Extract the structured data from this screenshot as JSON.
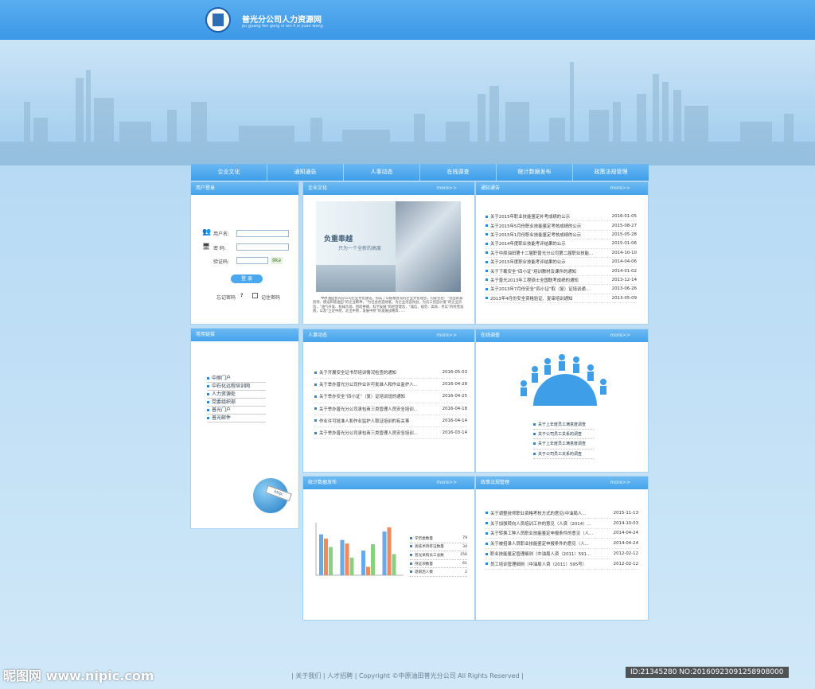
{
  "header": {
    "site_name": "普光分公司人力资源网",
    "site_name_pinyin": "pu guang fen gong si ren li zi yuan wang"
  },
  "nav": [
    "企业文化",
    "通知通告",
    "人事动态",
    "在线调查",
    "统计数据发布",
    "政策法规管理"
  ],
  "login": {
    "title": "用户登录",
    "username_label": "用户名:",
    "password_label": "密 码:",
    "captcha_label": "验证码:",
    "captcha_text": "9ka",
    "submit": "登 录",
    "forgot": "忘记密码",
    "remember": "记住密码"
  },
  "culture": {
    "title": "企业文化",
    "more": "more>>",
    "image_title": "负重奉越",
    "image_sub": "只为一个全新的高度",
    "text": "中原油田普光分公司企业文化建设，形成了以植根普光的企业文化理念，内容包括：“创业新泰创领、建设和谐油田”的企业精神，“为社会创造财富，为企业创造效益，为员工创造价值”的企业宗旨，“油气开发、机械市场、团结拼搏、科学发展”的经营理念，“诚信、规范、高效、务实”的经营准则，以及“立足中原，走出中原，发展中原”的发展战略等……"
  },
  "notices": {
    "title": "通知通告",
    "more": "more>>",
    "items": [
      {
        "t": "关于2015年职业技能鉴定补考成绩的公示",
        "d": "2016-01-05"
      },
      {
        "t": "关于2015年5月份职业技能鉴定考核成绩的公示",
        "d": "2015-08-27"
      },
      {
        "t": "关于2015年1月份职业技能鉴定考核成绩的公示",
        "d": "2015-05-28"
      },
      {
        "t": "关于2014年度职业技能考评结果的公示",
        "d": "2015-01-06"
      },
      {
        "t": "关于中原油田第十二届职普光分公司第二届职业技能...",
        "d": "2014-10-10"
      },
      {
        "t": "关于2015年度职业技能考评结果的公示",
        "d": "2014-04-06"
      },
      {
        "t": "关于下载安全“四小证”培训教材及课件的通知",
        "d": "2014-01-02"
      },
      {
        "t": "关于普光2013年工程硕士全国联考成绩的通知",
        "d": "2013-12-14"
      },
      {
        "t": "关于2013年7月份安全“四小证”取（复）证培训通...",
        "d": "2013-06-26"
      },
      {
        "t": "2013年4月份安全资格验证、复审培训通知",
        "d": "2013-05-09"
      }
    ]
  },
  "links": {
    "title": "常用链接",
    "items": [
      "中原门户",
      "中石化远程培训网",
      "人力资源处",
      "党委组织部",
      "普光门户",
      "普光邮件"
    ]
  },
  "hr_news": {
    "title": "人事动态",
    "more": "more>>",
    "items": [
      {
        "t": "关于开展安全证书尽培训情况检查的通知",
        "d": "2016-05-03"
      },
      {
        "t": "关于举办普光分公司作业许可批准人和作业监护人...",
        "d": "2016-04-28"
      },
      {
        "t": "关于举办安全“四小证”（复）证培训班的通知",
        "d": "2016-04-25"
      },
      {
        "t": "关于举办普光分公司承包商三类管理人员安全培训...",
        "d": "2016-04-18"
      },
      {
        "t": "作业许可批准人和作业监护人取证培训的有关事",
        "d": "2016-04-14"
      },
      {
        "t": "关于举办普光分公司承包商三类管理人员安全培训...",
        "d": "2016-03-14"
      }
    ]
  },
  "survey": {
    "title": "在线调查",
    "more": "more>>",
    "items": [
      "关于上年度员工满意度调查",
      "关于公司员工关系的调查",
      "关于上年度员工满意度调查",
      "关于公司员工关系的调查"
    ]
  },
  "stats": {
    "title": "统计数据发布",
    "more": "more>>",
    "items": [
      {
        "t": "学历类数量",
        "v": "79"
      },
      {
        "t": "高技术持有证数量",
        "v": "34"
      },
      {
        "t": "普光采购员工总数",
        "v": "256"
      },
      {
        "t": "持证领数量",
        "v": "61"
      },
      {
        "t": "退职后人数",
        "v": "2"
      }
    ]
  },
  "policy": {
    "title": "政策法规管理",
    "more": "more>>",
    "items": [
      {
        "t": "关于调整技师职业资格考核方式的意见(中油局人...",
        "d": "2015-11-13"
      },
      {
        "t": "关于加强转向人员培训工作的意见（人资（2014）...",
        "d": "2014-10-03"
      },
      {
        "t": "关于转换工种人员职业技能鉴定申报条件的意见（人...",
        "d": "2014-04-24"
      },
      {
        "t": "关于被招录人员职业技能鉴定申报条件的意见（人...",
        "d": "2014-04-24"
      },
      {
        "t": "职业技能鉴定管理细则（中油局人资（2011）591...",
        "d": "2012-02-12"
      },
      {
        "t": "员工培训管理细则（中油局人资（2011）595号）",
        "d": "2012-02-12"
      }
    ]
  },
  "chart_data": {
    "type": "bar",
    "categories": [
      "1",
      "2",
      "3",
      "4"
    ],
    "series": [
      {
        "name": "",
        "values": [
          58,
          50,
          35,
          62
        ]
      },
      {
        "name": "",
        "values": [
          52,
          45,
          12,
          68
        ]
      },
      {
        "name": "",
        "values": [
          40,
          25,
          44,
          30
        ]
      }
    ],
    "colors": [
      "#6aa9e6",
      "#f08a5d",
      "#8dcf82"
    ],
    "ylim": [
      0,
      70
    ]
  },
  "footer": {
    "text": "| 关于我们 | 人才招聘 | Copyright ©中原油田普光分公司 All Rights Reserved |",
    "watermark_left": "昵图网 www.nipic.com",
    "watermark_right": "ID:21345280 NO:20160923091258908000"
  }
}
